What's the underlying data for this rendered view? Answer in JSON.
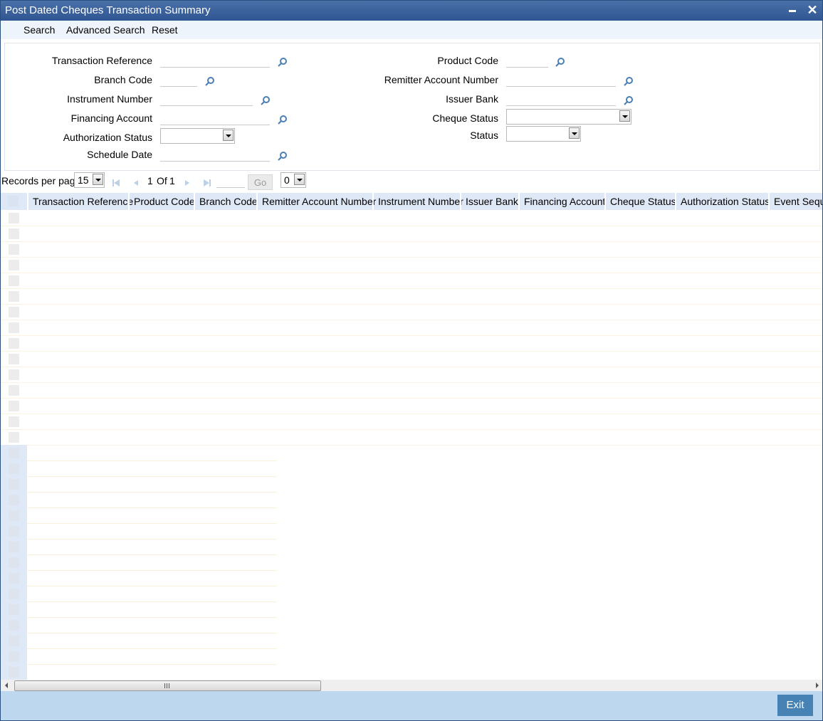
{
  "window": {
    "title": "Post Dated Cheques Transaction Summary",
    "minimize_icon": "minimize-icon",
    "close_icon": "close-icon"
  },
  "toolbar": {
    "search": "Search",
    "advanced_search": "Advanced Search",
    "reset": "Reset"
  },
  "search_form": {
    "left": [
      {
        "label": "Transaction Reference",
        "type": "lookup",
        "value": ""
      },
      {
        "label": "Branch Code",
        "type": "lookup",
        "value": ""
      },
      {
        "label": "Instrument Number",
        "type": "lookup",
        "value": ""
      },
      {
        "label": "Financing Account",
        "type": "lookup",
        "value": ""
      },
      {
        "label": "Authorization Status",
        "type": "select",
        "value": ""
      },
      {
        "label": "Schedule Date",
        "type": "lookup",
        "value": ""
      }
    ],
    "right": [
      {
        "label": "Product Code",
        "type": "lookup",
        "value": ""
      },
      {
        "label": "Remitter Account Number",
        "type": "lookup",
        "value": ""
      },
      {
        "label": "Issuer Bank",
        "type": "lookup",
        "value": ""
      },
      {
        "label": "Cheque Status",
        "type": "select",
        "value": ""
      },
      {
        "label": "Status",
        "type": "select",
        "value": ""
      }
    ]
  },
  "pager": {
    "records_per_page_label": "Records per page",
    "records_per_page": "15",
    "current_page": "1",
    "of_label": "Of",
    "total_pages": "1",
    "goto_value": "",
    "go_label": "Go",
    "extra_select": "0"
  },
  "grid": {
    "columns": [
      "Transaction Reference",
      "Product Code",
      "Branch Code",
      "Remitter Account Number",
      "Instrument Number",
      "Issuer Bank",
      "Financing Account",
      "Cheque Status",
      "Authorization Status",
      "Event Seque"
    ],
    "rows": []
  },
  "footer": {
    "exit_label": "Exit"
  },
  "colors": {
    "titlebar": "#2f5692",
    "toolbar_bg": "#eef4fb",
    "grid_header": "#dfe8f6",
    "footer_bg": "#bdd8ee",
    "exit_button": "#4682b4"
  }
}
